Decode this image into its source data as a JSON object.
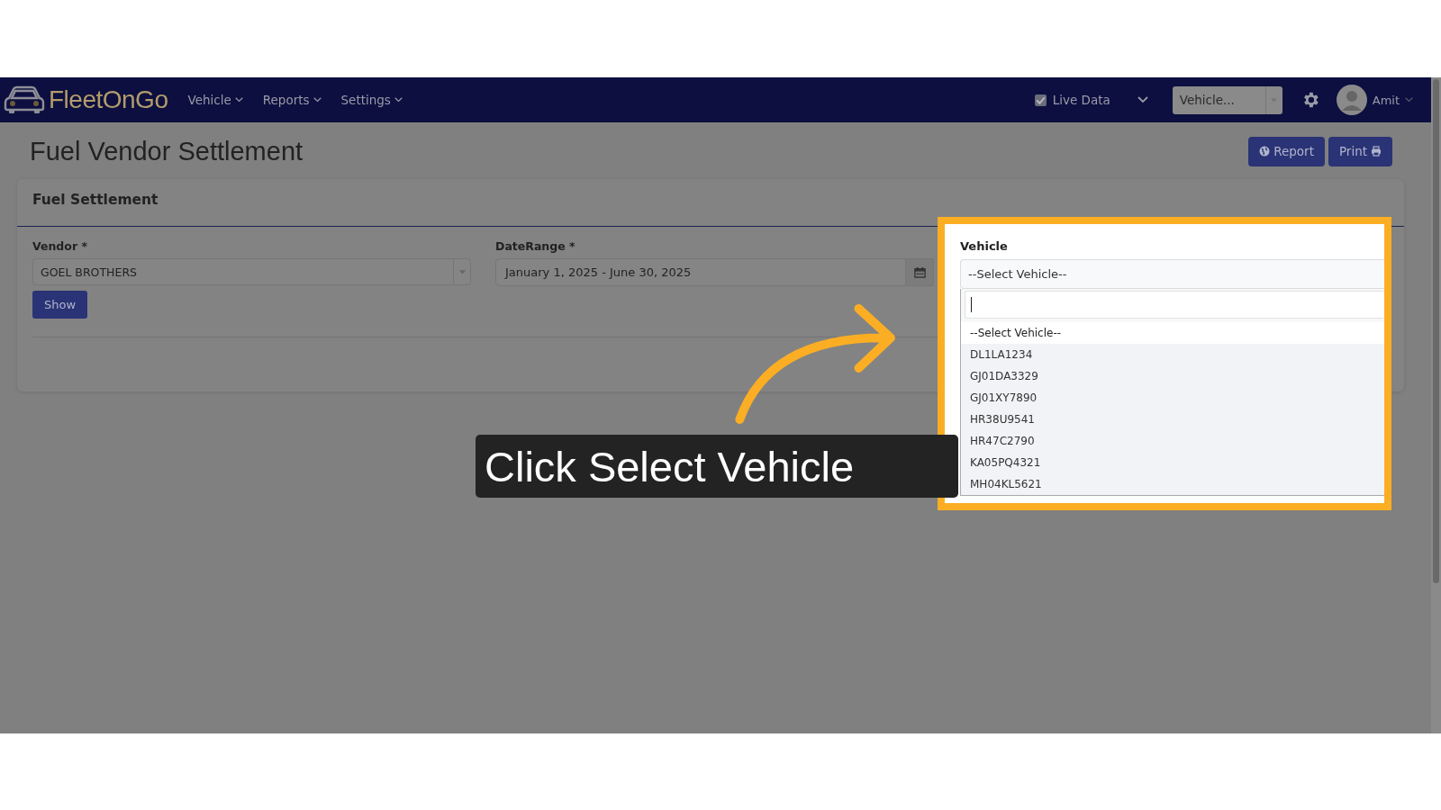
{
  "navbar": {
    "logo": "FleetOnGo",
    "menu": [
      {
        "label": "Vehicle"
      },
      {
        "label": "Reports"
      },
      {
        "label": "Settings"
      }
    ],
    "live_data": {
      "label": "Live Data",
      "checked": true
    },
    "vehicle_select": {
      "value": "Vehicle..."
    },
    "user": {
      "name": "Amit"
    }
  },
  "page": {
    "title": "Fuel Vendor Settlement",
    "buttons": [
      {
        "label": "Report"
      },
      {
        "label": "Print"
      }
    ]
  },
  "card": {
    "title": "Fuel Settlement",
    "vendor": {
      "label": "Vendor *",
      "value": "GOEL BROTHERS"
    },
    "date_range": {
      "label": "DateRange *",
      "value": "January 1, 2025 - June 30, 2025"
    },
    "show_button": "Show"
  },
  "vehicle": {
    "label": "Vehicle",
    "value": "--Select Vehicle--",
    "options": [
      {
        "label": "--Select Vehicle--",
        "selected": true
      },
      {
        "label": "DL1LA1234",
        "selected": false
      },
      {
        "label": "GJ01DA3329",
        "selected": false
      },
      {
        "label": "GJ01XY7890",
        "selected": false
      },
      {
        "label": "HR38U9541",
        "selected": false
      },
      {
        "label": "HR47C2790",
        "selected": false
      },
      {
        "label": "KA05PQ4321",
        "selected": false
      },
      {
        "label": "MH04KL5621",
        "selected": false
      }
    ]
  },
  "caption": "Click Select Vehicle"
}
